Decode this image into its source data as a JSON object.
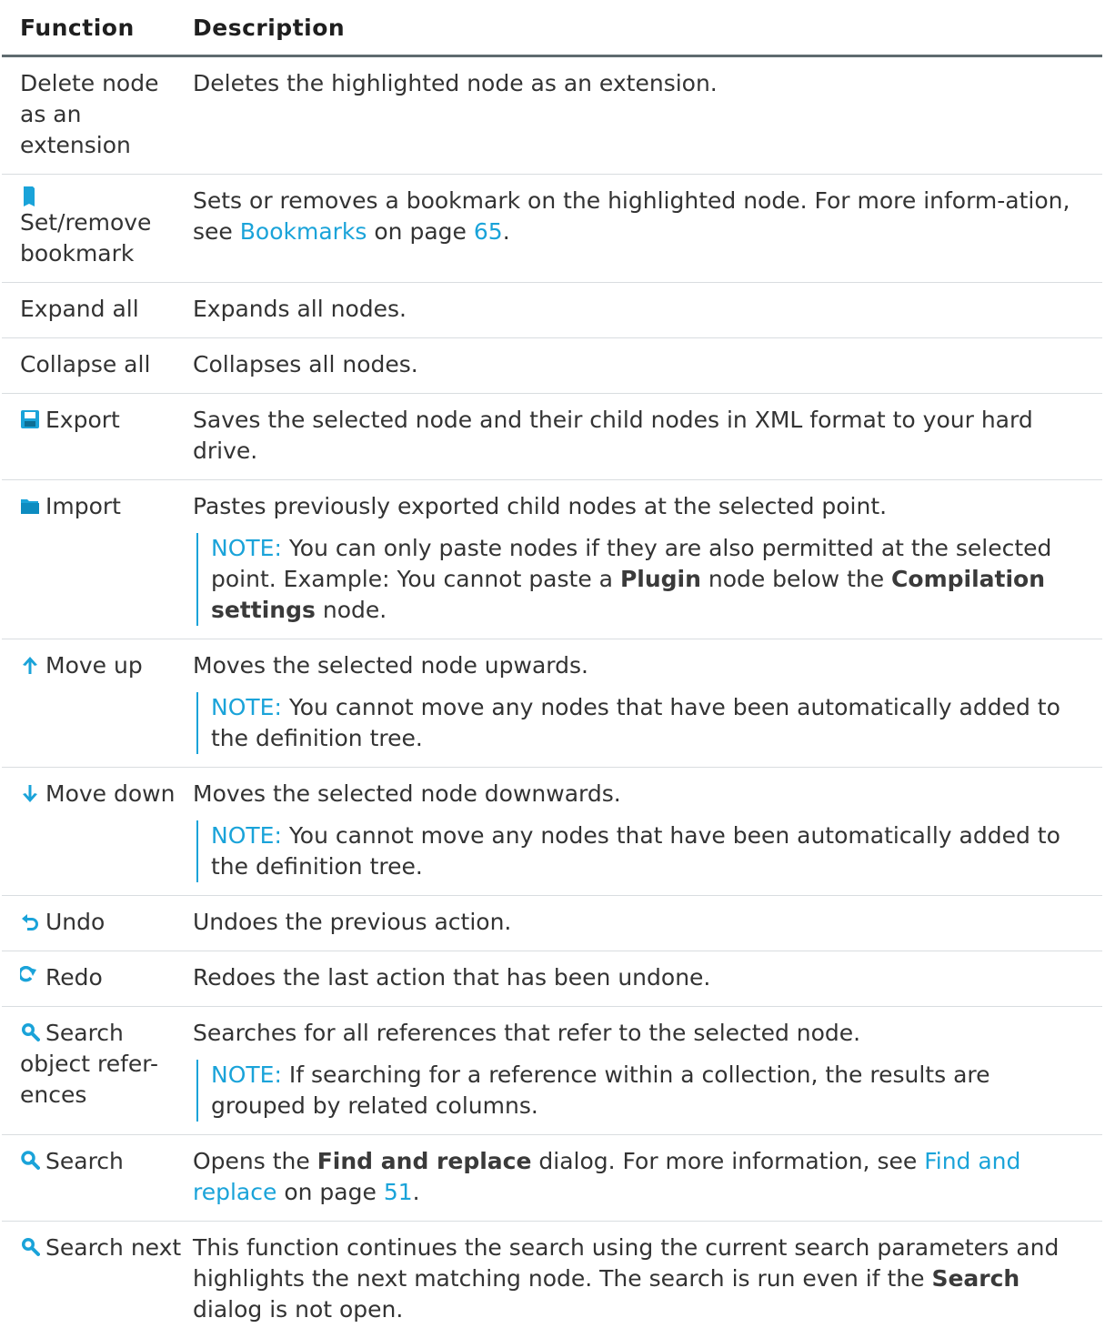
{
  "header": {
    "function": "Function",
    "description": "Description"
  },
  "rows": {
    "delete": {
      "function": "Delete node as an extension",
      "description": "Deletes the highlighted node as an extension."
    },
    "bookmark": {
      "function": "Set/remove bookmark",
      "icon": "bookmark-icon",
      "desc_pre": "Sets or removes a bookmark on the highlighted node. For more inform-ation, see",
      "link": "Bookmarks",
      "mid": "on page",
      "page": "65",
      "end": "."
    },
    "expand": {
      "function": "Expand all",
      "description": "Expands all nodes."
    },
    "collapse": {
      "function": "Collapse all",
      "description": "Collapses all nodes."
    },
    "export": {
      "function": "Export",
      "icon": "save-icon",
      "description": "Saves the selected node and their child nodes in XML format to your hard drive."
    },
    "import": {
      "function": "Import",
      "icon": "folder-icon",
      "description": "Pastes previously exported child nodes at the selected point.",
      "note_label": "NOTE:",
      "note_pre": "You can only paste nodes if they are also permitted at the selected point. Example: You cannot paste a",
      "note_b1": "Plugin",
      "note_mid": "node below the",
      "note_b2": "Compilation settings",
      "note_end": "node."
    },
    "moveup": {
      "function": "Move up",
      "icon": "arrow-up-icon",
      "description": "Moves the selected node upwards.",
      "note_label": "NOTE:",
      "note": "You cannot move any nodes that have been automatically added to the definition tree."
    },
    "movedown": {
      "function": "Move down",
      "icon": "arrow-down-icon",
      "description": "Moves the selected node downwards.",
      "note_label": "NOTE:",
      "note": "You cannot move any nodes that have been automatically added to the definition tree."
    },
    "undo": {
      "function": "Undo",
      "icon": "undo-icon",
      "description": "Undoes the previous action."
    },
    "redo": {
      "function": "Redo",
      "icon": "redo-icon",
      "description": "Redoes the last action that has been undone."
    },
    "searchref": {
      "function": "Search object refer-ences",
      "icon": "search-references-icon",
      "description": "Searches for all references that refer to the selected node.",
      "note_label": "NOTE:",
      "note": "If searching for a reference within a collection, the results are grouped by related columns."
    },
    "search": {
      "function": "Search",
      "icon": "search-icon",
      "desc_pre": "Opens the",
      "bold": "Find and replace",
      "desc_mid": "dialog. For more information, see",
      "link": "Find and replace",
      "mid": "on page",
      "page": "51",
      "end": "."
    },
    "searchnext": {
      "function": "Search next",
      "icon": "search-next-icon",
      "desc_pre": "This function continues the search using the current search parameters and highlights the next matching node. The search is run even if the",
      "bold": "Search",
      "desc_end": "dialog is not open."
    }
  },
  "colors": {
    "link": "#1aa3d9",
    "text": "#333333",
    "icon": "#1aa3d9"
  }
}
